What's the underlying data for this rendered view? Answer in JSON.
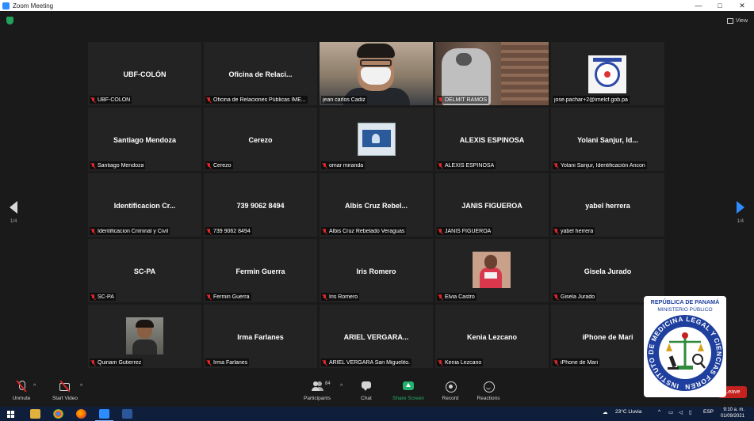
{
  "window": {
    "title": "Zoom Meeting",
    "minimize_glyph": "—",
    "maximize_glyph": "□",
    "close_glyph": "✕"
  },
  "top": {
    "view_label": "View"
  },
  "pagination": {
    "left": "1/4",
    "right": "1/4"
  },
  "tiles": [
    {
      "big": "UBF-COLÓN",
      "label": "UBF-COLÓN"
    },
    {
      "big": "Oficina  de  Relaci...",
      "label": "Oficina de Relaciones Públicas IME..."
    },
    {
      "big": "",
      "label": "jean carlos Cadiz"
    },
    {
      "big": "",
      "label": "DELMIT RAMOS"
    },
    {
      "big": "",
      "label": "jose.pachar+2@imelcf.gob.pa"
    },
    {
      "big": "Santiago Mendoza",
      "label": "Santiago Mendoza"
    },
    {
      "big": "Cerezo",
      "label": "Cerezo"
    },
    {
      "big": "",
      "label": "omar miranda"
    },
    {
      "big": "ALEXIS ESPINOSA",
      "label": "ALEXIS ESPINOSA"
    },
    {
      "big": "Yolani  Sanjur,  Id...",
      "label": "Yolani Sanjur, Identificación Ancon"
    },
    {
      "big": "Identificacion  Cr...",
      "label": "Identificacion Criminal y Civil"
    },
    {
      "big": "739 9062 8494",
      "label": "739 9062 8494"
    },
    {
      "big": "Albis  Cruz  Rebel...",
      "label": "Albis Cruz Rebelado Veraguas"
    },
    {
      "big": "JANIS FIGUEROA",
      "label": "JANIS FIGUEROA"
    },
    {
      "big": "yabel herrera",
      "label": "yabel herrera"
    },
    {
      "big": "SC-PA",
      "label": "SC-PA"
    },
    {
      "big": "Fermin Guerra",
      "label": "Fermin Guerra"
    },
    {
      "big": "Iris Romero",
      "label": "Iris Romero"
    },
    {
      "big": "",
      "label": "Elvia Castro"
    },
    {
      "big": "Gisela Jurado",
      "label": "Gisela Jurado"
    },
    {
      "big": "",
      "label": "Quiriam Gutierrez"
    },
    {
      "big": "Irma Farlanes",
      "label": "Irma Farlanes"
    },
    {
      "big": "ARIEL  VERGARA...",
      "label": "ARIEL VERGARA  San Miguelito."
    },
    {
      "big": "Kenia Lezcano",
      "label": "Kenia Lezcano"
    },
    {
      "big": "iPhone de Mari",
      "label": "iPhone de Mari"
    }
  ],
  "seal_photo": {
    "title1": "REPUBLICA DE PANAMA",
    "title2": "MINISTERIO PUBLICO"
  },
  "toolbar": {
    "unmute": "Unmute",
    "start_video": "Start Video",
    "participants": "Participants",
    "participants_count": "84",
    "chat": "Chat",
    "share_screen": "Share Screen",
    "record": "Record",
    "reactions": "Reactions",
    "leave": "Leave",
    "caret": "^"
  },
  "overlay_seal": {
    "top_line1": "REPÚBLICA DE PANAMÁ",
    "top_line2": "MINISTERIO PÚBLICO",
    "ring_text": "INSTITUTO DE MEDICINA LEGAL Y CIENCIAS FORENSES"
  },
  "taskbar": {
    "weather": "23°C  Lluvia",
    "lang": "ESP",
    "time": "9:10 a. m.",
    "date": "01/09/2021"
  },
  "colors": {
    "accent_blue": "#2d8cff",
    "active_speaker": "#b7e23b",
    "leave_red": "#c5221f",
    "share_green": "#23b26d",
    "muted_red": "#e02828"
  }
}
